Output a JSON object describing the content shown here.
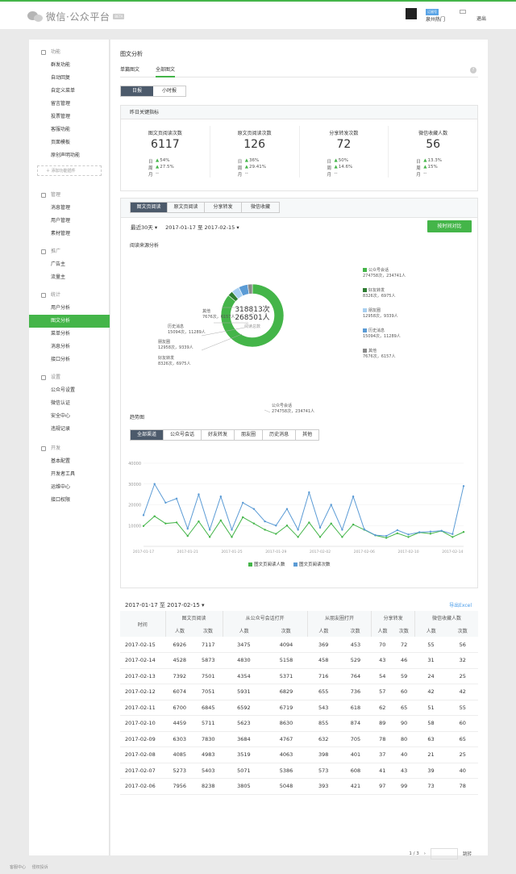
{
  "header": {
    "brand": "微信·公众平台",
    "beta": "BETA",
    "account_tag": "订阅号",
    "account_name": "泉州热门",
    "logout": "退出"
  },
  "sidebar": {
    "groups": [
      {
        "title": "功能",
        "items": [
          "群发功能",
          "自动回复",
          "自定义菜单",
          "留言管理",
          "投票管理",
          "客服功能",
          "页面模板",
          "原创声明功能"
        ],
        "add": "＋ 添加功能插件"
      },
      {
        "title": "管理",
        "items": [
          "消息管理",
          "用户管理",
          "素材管理"
        ]
      },
      {
        "title": "推广",
        "items": [
          "广告主",
          "流量主"
        ]
      },
      {
        "title": "统计",
        "items": [
          "用户分析",
          "图文分析",
          "菜单分析",
          "消息分析",
          "接口分析"
        ],
        "active": 1
      },
      {
        "title": "设置",
        "items": [
          "公众号设置",
          "微信认证",
          "安全中心",
          "违规记录"
        ]
      },
      {
        "title": "开发",
        "items": [
          "基本配置",
          "开发者工具",
          "运维中心",
          "接口权限"
        ]
      }
    ]
  },
  "main": {
    "title": "图文分析",
    "tabs": [
      "单篇图文",
      "全部图文"
    ],
    "help": "?",
    "period_tabs": [
      "日报",
      "小时报"
    ],
    "kpi_title": "昨日关键指标",
    "kpis": [
      {
        "label": "图文页阅读次数",
        "value": "6117",
        "day": "54%",
        "week": "27.5%",
        "month": "--"
      },
      {
        "label": "原文页阅读次数",
        "value": "126",
        "day": "36%",
        "week": "29.41%",
        "month": "--"
      },
      {
        "label": "分享转发次数",
        "value": "72",
        "day": "50%",
        "week": "14.6%",
        "month": "--"
      },
      {
        "label": "微信收藏人数",
        "value": "56",
        "day": "13.3%",
        "week": "15%",
        "month": "--"
      }
    ],
    "kpi_row_labels": {
      "day": "日",
      "week": "周",
      "month": "月"
    },
    "metric_tabs": [
      "图文页阅读",
      "原文页阅读",
      "分享转发",
      "微信收藏"
    ],
    "range": {
      "preset": "最近30天",
      "dates": "2017-01-17 至 2017-02-15"
    },
    "compare_button": "按时间对比",
    "source_title": "阅读来源分析",
    "donut": {
      "total_times": "318813次",
      "total_people": "268501人",
      "center_caption": "阅读总数"
    },
    "sources": [
      {
        "name": "公众号会话",
        "detail": "274758次，234741人",
        "value": 274758,
        "color": "#44b549"
      },
      {
        "name": "好友转发",
        "detail": "8326次，6975人",
        "value": 8326,
        "color": "#2e7d32"
      },
      {
        "name": "朋友圈",
        "detail": "12958次，9339人",
        "value": 12958,
        "color": "#a8cff0"
      },
      {
        "name": "历史消息",
        "detail": "15094次，11289人",
        "value": 15094,
        "color": "#5b9bd5"
      },
      {
        "name": "其他",
        "detail": "7676次，6157人",
        "value": 7676,
        "color": "#8a8a8a"
      }
    ],
    "trend_title": "趋势图",
    "trend_tabs": [
      "全部渠道",
      "公众号会话",
      "好友转发",
      "朋友圈",
      "历史消息",
      "其他"
    ],
    "table": {
      "range": "2017-01-17 至 2017-02-15",
      "export": "导出Excel",
      "col_time": "时间",
      "groups": [
        "图文页阅读",
        "从公众号会话打开",
        "从朋友圈打开",
        "分享转发",
        "微信收藏人数"
      ],
      "sub": [
        "人数",
        "次数"
      ],
      "rows": [
        [
          "2017-02-15",
          "6926",
          "7117",
          "3475",
          "4094",
          "369",
          "453",
          "70",
          "72",
          "55",
          "56"
        ],
        [
          "2017-02-14",
          "4528",
          "5873",
          "4830",
          "5158",
          "458",
          "529",
          "43",
          "46",
          "31",
          "32"
        ],
        [
          "2017-02-13",
          "7392",
          "7501",
          "4354",
          "5371",
          "716",
          "764",
          "54",
          "59",
          "24",
          "25"
        ],
        [
          "2017-02-12",
          "6074",
          "7051",
          "5931",
          "6829",
          "655",
          "736",
          "57",
          "60",
          "42",
          "42"
        ],
        [
          "2017-02-11",
          "6700",
          "6845",
          "6592",
          "6719",
          "543",
          "618",
          "62",
          "65",
          "51",
          "55"
        ],
        [
          "2017-02-10",
          "4459",
          "5711",
          "5623",
          "8630",
          "855",
          "874",
          "89",
          "90",
          "58",
          "60"
        ],
        [
          "2017-02-09",
          "6303",
          "7830",
          "3684",
          "4767",
          "632",
          "705",
          "78",
          "80",
          "63",
          "65"
        ],
        [
          "2017-02-08",
          "4085",
          "4983",
          "3519",
          "4063",
          "398",
          "401",
          "37",
          "40",
          "21",
          "25"
        ],
        [
          "2017-02-07",
          "5273",
          "5403",
          "5071",
          "5386",
          "573",
          "608",
          "41",
          "43",
          "39",
          "40"
        ],
        [
          "2017-02-06",
          "7956",
          "8238",
          "3805",
          "5048",
          "393",
          "421",
          "97",
          "99",
          "73",
          "78"
        ]
      ],
      "pager": {
        "page": "1 / 3",
        "jump": "跳转"
      }
    }
  },
  "footer": {
    "links": [
      "客服中心",
      "侵权投诉"
    ]
  },
  "chart_data": {
    "type": "line",
    "title": "趋势图",
    "x": [
      "2017-01-17",
      "2017-01-18",
      "2017-01-19",
      "2017-01-20",
      "2017-01-21",
      "2017-01-22",
      "2017-01-23",
      "2017-01-24",
      "2017-01-25",
      "2017-01-26",
      "2017-01-27",
      "2017-01-28",
      "2017-01-29",
      "2017-01-30",
      "2017-01-31",
      "2017-02-01",
      "2017-02-02",
      "2017-02-03",
      "2017-02-04",
      "2017-02-05",
      "2017-02-06",
      "2017-02-07",
      "2017-02-08",
      "2017-02-09",
      "2017-02-10",
      "2017-02-11",
      "2017-02-12",
      "2017-02-13",
      "2017-02-14",
      "2017-02-15"
    ],
    "x_tick_labels": [
      "2017-01-17",
      "2017-01-21",
      "2017-01-25",
      "2017-01-29",
      "2017-02-02",
      "2017-02-06",
      "2017-02-10",
      "2017-02-14"
    ],
    "ylim": [
      0,
      40000
    ],
    "yticks": [
      "40000",
      "30000",
      "20000",
      "10000"
    ],
    "grid": true,
    "legend_position": "bottom",
    "series": [
      {
        "name": "图文页阅读人数",
        "color": "#44b549",
        "values": [
          9800,
          14500,
          11000,
          11500,
          5000,
          12000,
          4500,
          12500,
          4500,
          14000,
          11000,
          8000,
          6000,
          10000,
          4500,
          11500,
          4500,
          11000,
          4500,
          10500,
          8000,
          5300,
          4100,
          6300,
          4500,
          6700,
          6100,
          7400,
          4500,
          6900
        ]
      },
      {
        "name": "图文页阅读次数",
        "color": "#5b9bd5",
        "values": [
          15000,
          30000,
          21000,
          23000,
          8500,
          25000,
          8000,
          24000,
          8000,
          21000,
          18000,
          12000,
          10000,
          18000,
          8000,
          26000,
          9000,
          20000,
          8000,
          24000,
          8200,
          5400,
          5000,
          7800,
          5700,
          6800,
          7100,
          7500,
          5900,
          29000
        ]
      }
    ]
  }
}
